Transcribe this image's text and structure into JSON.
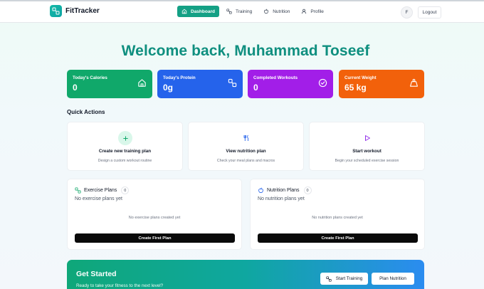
{
  "brand": {
    "name": "FitTracker"
  },
  "nav": {
    "items": [
      {
        "label": "Dashboard",
        "icon": "home-icon",
        "active": true
      },
      {
        "label": "Training",
        "icon": "dumbbell-icon",
        "active": false
      },
      {
        "label": "Nutrition",
        "icon": "apple-icon",
        "active": false
      },
      {
        "label": "Profile",
        "icon": "user-icon",
        "active": false
      }
    ],
    "avatar_initial": "F",
    "logout_label": "Logout"
  },
  "welcome": {
    "title": "Welcome back, Muhammad Toseef"
  },
  "stats": [
    {
      "label": "Today's Calories",
      "value": "0",
      "icon": "home-icon",
      "color": "#10a86a"
    },
    {
      "label": "Today's Protein",
      "value": "0g",
      "icon": "dumbbell-icon",
      "color": "#2563eb"
    },
    {
      "label": "Completed Workouts",
      "value": "0",
      "icon": "check-circle-icon",
      "color": "#a21ee8"
    },
    {
      "label": "Current Weight",
      "value": "65 kg",
      "icon": "weight-icon",
      "color": "#f2610b"
    }
  ],
  "quick_actions": {
    "title": "Quick Actions",
    "items": [
      {
        "name": "Create new training plan",
        "desc": "Design a custom workout routine",
        "icon": "plus-icon"
      },
      {
        "name": "View nutrition plan",
        "desc": "Check your meal plans and macros",
        "icon": "utensils-icon"
      },
      {
        "name": "Start workout",
        "desc": "Begin your scheduled exercise session",
        "icon": "play-icon"
      }
    ]
  },
  "plans": {
    "exercise": {
      "title": "Exercise Plans",
      "count": "0",
      "subtitle": "No exercise plans yet",
      "empty": "No exercise plans created yet",
      "button": "Create First Plan"
    },
    "nutrition": {
      "title": "Nutrition Plans",
      "count": "0",
      "subtitle": "No nutrition plans yet",
      "empty": "No nutrition plans created yet",
      "button": "Create First Plan"
    }
  },
  "get_started": {
    "title": "Get Started",
    "subtitle": "Ready to take your fitness to the next level?",
    "start_training": "Start Training",
    "plan_nutrition": "Plan Nutrition"
  },
  "colors": {
    "accent": "#14a085",
    "title": "#0f8f7f"
  }
}
